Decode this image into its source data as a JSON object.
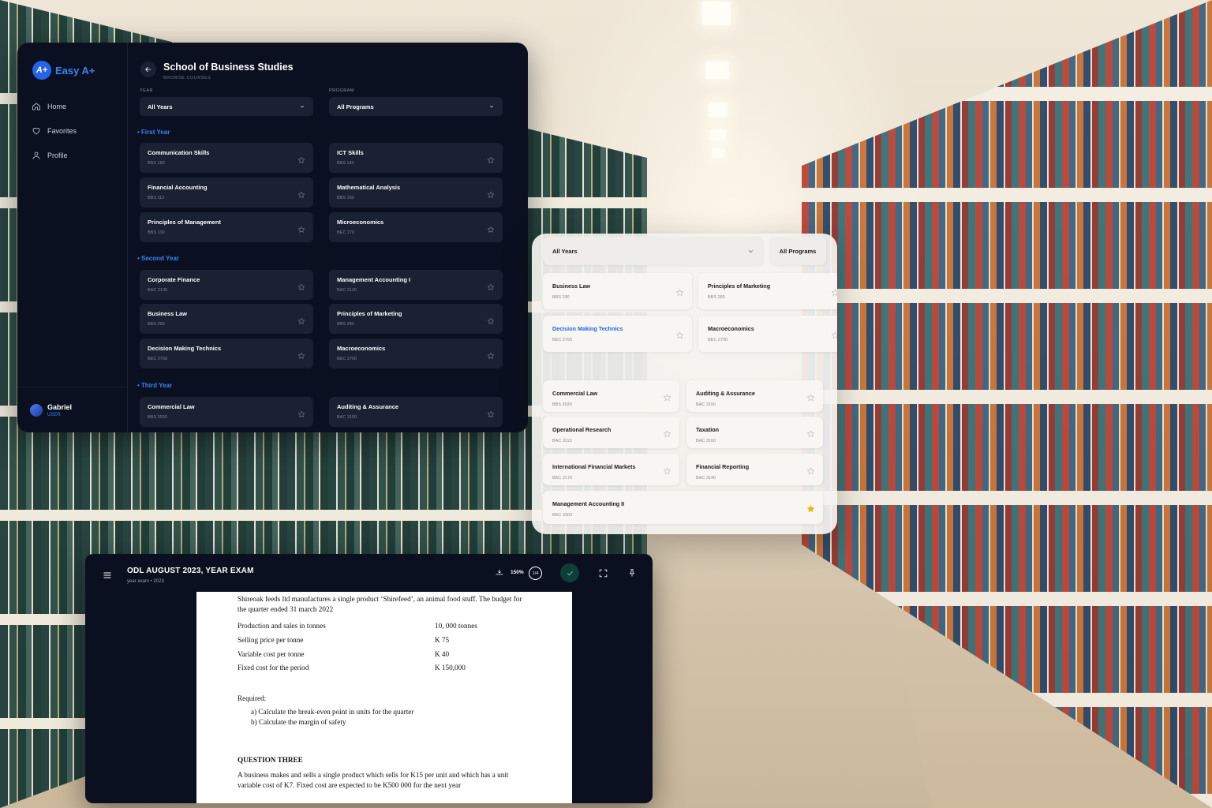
{
  "app": {
    "brand": "Easy A+",
    "brand_mark": "A+",
    "nav": [
      {
        "label": "Home",
        "icon": "home-icon"
      },
      {
        "label": "Favorites",
        "icon": "heart-icon"
      },
      {
        "label": "Profile",
        "icon": "user-icon"
      }
    ],
    "user": {
      "name": "Gabriel",
      "role": "USER"
    },
    "page_title": "School of Business Studies",
    "page_subtitle": "BROWSE COURSES",
    "filters": {
      "year_label": "YEAR",
      "year_value": "All Years",
      "program_label": "PROGRAM",
      "program_value": "All Programs"
    },
    "sections": [
      {
        "title": "• First Year",
        "courses": [
          {
            "name": "Communication Skills",
            "code": "BBS 180"
          },
          {
            "name": "ICT Skills",
            "code": "BBS 140"
          },
          {
            "name": "Financial Accounting",
            "code": "BBS 110"
          },
          {
            "name": "Mathematical Analysis",
            "code": "BBS 160"
          },
          {
            "name": "Principles of Management",
            "code": "BBS 130"
          },
          {
            "name": "Microeconomics",
            "code": "BEC 170"
          }
        ]
      },
      {
        "title": "• Second Year",
        "courses": [
          {
            "name": "Corporate Finance",
            "code": "BAC 2130"
          },
          {
            "name": "Management Accounting I",
            "code": "BAC 2120"
          },
          {
            "name": "Business Law",
            "code": "BBS 290"
          },
          {
            "name": "Principles of Marketing",
            "code": "BBS 280"
          },
          {
            "name": "Decision Making Technics",
            "code": "BEC 2760"
          },
          {
            "name": "Macroeconomics",
            "code": "BEC 2700"
          }
        ]
      },
      {
        "title": "• Third Year",
        "courses": [
          {
            "name": "Commercial Law",
            "code": "BBS 3930"
          },
          {
            "name": "Auditing & Assurance",
            "code": "BAC 3150"
          }
        ]
      }
    ]
  },
  "light_panel": {
    "year_value": "All Years",
    "program_value": "All Programs",
    "top_courses": [
      {
        "name": "Business Law",
        "code": "BBS 290",
        "active": false,
        "favorite": false
      },
      {
        "name": "Principles of Marketing",
        "code": "BBS 280",
        "active": false,
        "favorite": false
      },
      {
        "name": "Decision Making Technics",
        "code": "BEC 2760",
        "active": true,
        "favorite": false
      },
      {
        "name": "Macroeconomics",
        "code": "BEC 2700",
        "active": false,
        "favorite": false
      }
    ],
    "bottom_courses": [
      {
        "name": "Commercial Law",
        "code": "BBS 3930",
        "favorite": false
      },
      {
        "name": "Auditing & Assurance",
        "code": "BAC 3150",
        "favorite": false
      },
      {
        "name": "Operational Research",
        "code": "BAC 3110",
        "favorite": false
      },
      {
        "name": "Taxation",
        "code": "BAC 3160",
        "favorite": false
      },
      {
        "name": "International Financial Markets",
        "code": "BAC 3170",
        "favorite": false
      },
      {
        "name": "Financial Reporting",
        "code": "BAC 3140",
        "favorite": false
      },
      {
        "name": "Management Accounting II",
        "code": "BAC 3300",
        "favorite": true
      }
    ]
  },
  "exam": {
    "title": "ODL AUGUST 2023, YEAR EXAM",
    "subtitle": "year exam • 2023",
    "zoom": "150%",
    "page_indicator": "1/4",
    "paper": {
      "intro": "Shireoak feeds ltd manufactures a single product ‘Shirefeed’, an animal food stuff. The budget for the quarter ended 31 march 2022",
      "rows": [
        {
          "k": "Production and sales in tonnes",
          "v": "10, 000 tonnes"
        },
        {
          "k": "Selling price per tonne",
          "v": "K 75"
        },
        {
          "k": "Variable cost per tonne",
          "v": "K 40"
        },
        {
          "k": "Fixed cost for the period",
          "v": "K 150,000"
        }
      ],
      "required": "Required:",
      "required_items": [
        "a)    Calculate the break-even point in units for the quarter",
        "b)    Calculate the margin of safety"
      ],
      "q3_title": "QUESTION THREE",
      "q3_text": "A business makes and sells a single product which sells for K15 per unit and which has a unit variable cost of K7. Fixed cost are expected to be K500 000 for the next year"
    }
  },
  "colors": {
    "accent": "#3b82f6",
    "dark_bg": "#0b1020",
    "card_bg": "#1a2133",
    "star_on": "#f5b301",
    "check_green": "#3fd6b8"
  }
}
